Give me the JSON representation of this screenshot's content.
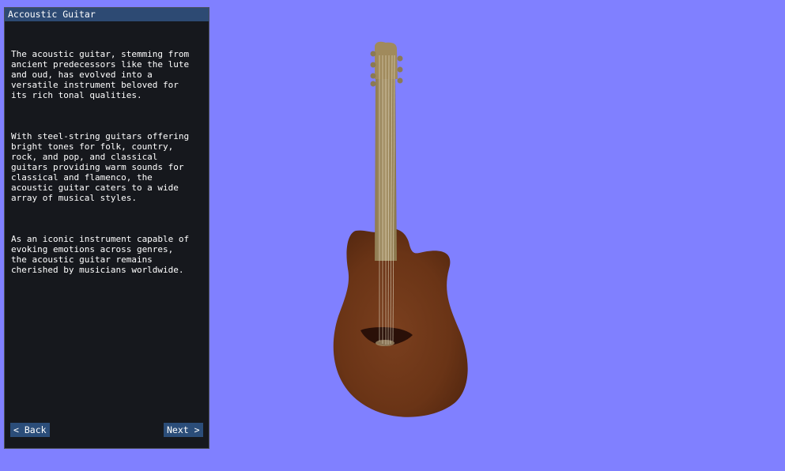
{
  "window": {
    "title": "Accoustic Guitar"
  },
  "content": {
    "paragraphs": [
      "The acoustic guitar, stemming from\nancient predecessors like the lute\nand oud, has evolved into a\nversatile instrument beloved for\nits rich tonal qualities.",
      "With steel-string guitars offering\nbright tones for folk, country,\nrock, and pop, and classical\nguitars providing warm sounds for\nclassical and flamenco, the\nacoustic guitar caters to a wide\narray of musical styles.",
      "As an iconic instrument capable of\nevoking emotions across genres,\nthe acoustic guitar remains\ncherished by musicians worldwide."
    ]
  },
  "nav": {
    "back_label": "< Back",
    "next_label": "Next >"
  },
  "scene": {
    "background_color": "#8080ff",
    "model_icon": "acoustic-guitar-3d-model"
  }
}
